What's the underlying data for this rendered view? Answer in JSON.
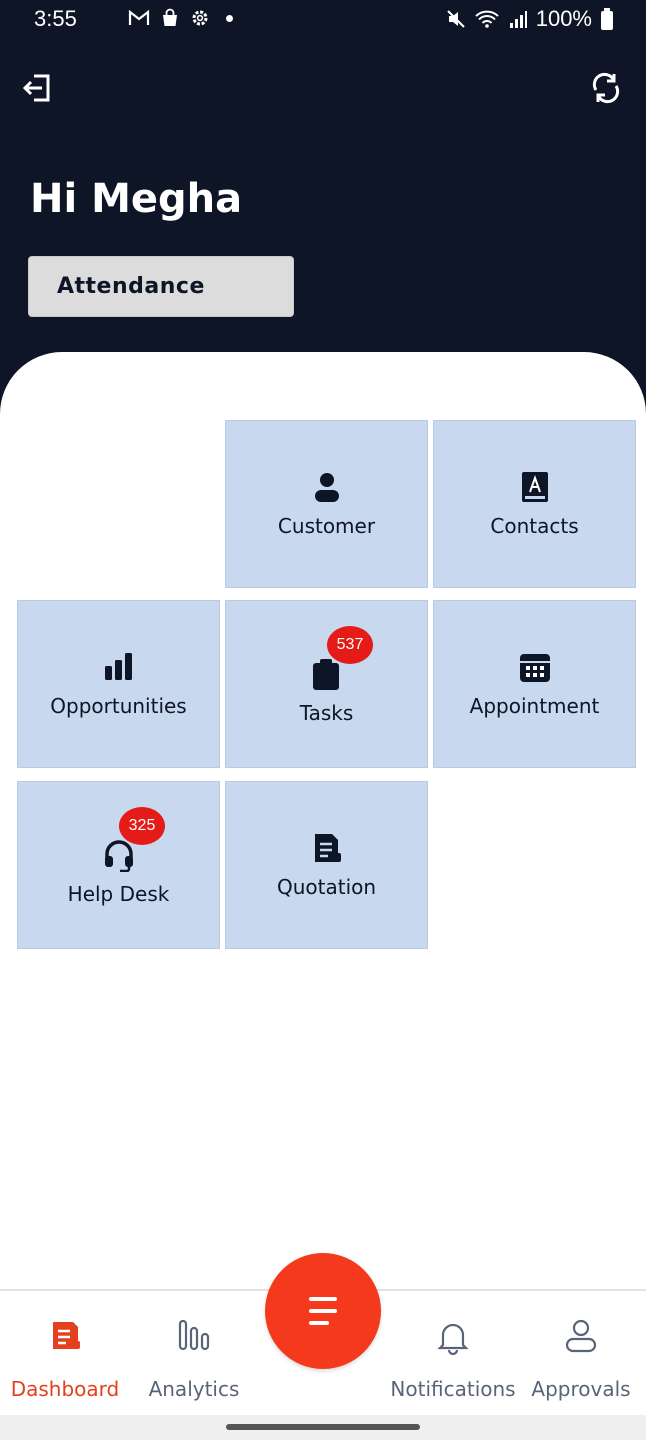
{
  "status_bar": {
    "time": "3:55",
    "battery": "100%",
    "icons": [
      "gmail-icon",
      "shopping-bag-icon",
      "settings-icon",
      "notification-dot",
      "mute-icon",
      "wifi-icon",
      "signal-icon",
      "battery-icon"
    ]
  },
  "header": {
    "greeting": "Hi Megha",
    "attendance_label": "Attendance",
    "background_color": "#0d1526",
    "left_icon": "logout-icon",
    "right_icon": "sync-icon"
  },
  "tiles": [
    {
      "label": "Customer",
      "icon": "person-icon"
    },
    {
      "label": "Contacts",
      "icon": "contact-book-icon"
    },
    {
      "label": "Opportunities",
      "icon": "bar-chart-icon"
    },
    {
      "label": "Tasks",
      "icon": "clipboard-icon",
      "badge": "537"
    },
    {
      "label": "Appointment",
      "icon": "calendar-icon"
    },
    {
      "label": "Help Desk",
      "icon": "headset-icon",
      "badge": "325"
    },
    {
      "label": "Quotation",
      "icon": "document-icon"
    }
  ],
  "tile_color": "#c8d8ee",
  "badge_color": "#e41b17",
  "bottom_nav": {
    "items": [
      {
        "label": "Dashboard",
        "icon": "dashboard-icon",
        "active": true
      },
      {
        "label": "Analytics",
        "icon": "analytics-icon",
        "active": false
      },
      {
        "label": "Notifications",
        "icon": "bell-icon",
        "active": false
      },
      {
        "label": "Approvals",
        "icon": "user-icon",
        "active": false
      }
    ],
    "active_color": "#e3401e",
    "fab_icon": "menu-icon",
    "fab_color": "#f5391d"
  }
}
